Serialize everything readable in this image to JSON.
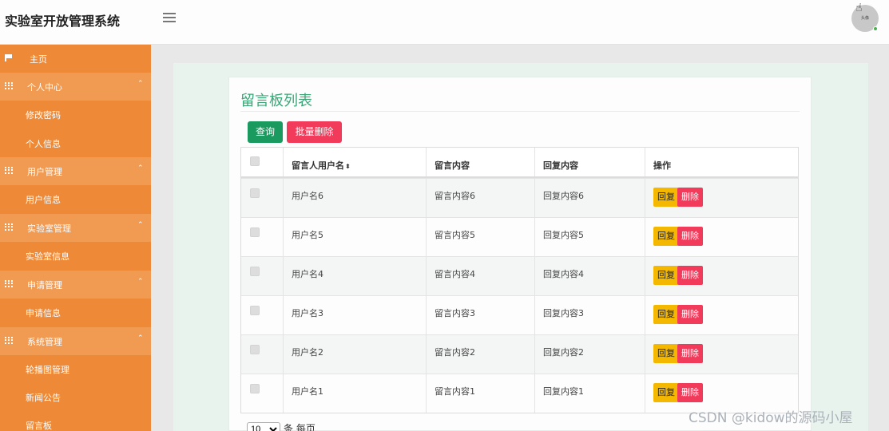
{
  "header": {
    "title": "实验室开放管理系统",
    "avatar_text": "头像"
  },
  "sidebar": {
    "items": [
      {
        "label": "主页",
        "type": "home",
        "icon": "flag-icon"
      },
      {
        "label": "个人中心",
        "type": "group",
        "icon": "grid-icon",
        "caret": "⌃"
      },
      {
        "label": "修改密码",
        "type": "sub"
      },
      {
        "label": "个人信息",
        "type": "sub"
      },
      {
        "label": "用户管理",
        "type": "group",
        "icon": "grid-icon",
        "caret": "⌃"
      },
      {
        "label": "用户信息",
        "type": "sub"
      },
      {
        "label": "实验室管理",
        "type": "group",
        "icon": "grid-icon",
        "caret": "⌃"
      },
      {
        "label": "实验室信息",
        "type": "sub"
      },
      {
        "label": "申请管理",
        "type": "group",
        "icon": "grid-icon",
        "caret": "⌃"
      },
      {
        "label": "申请信息",
        "type": "sub"
      },
      {
        "label": "系统管理",
        "type": "group",
        "icon": "grid-icon",
        "caret": "⌃"
      },
      {
        "label": "轮播图管理",
        "type": "sub"
      },
      {
        "label": "新闻公告",
        "type": "sub"
      },
      {
        "label": "留言板",
        "type": "sub"
      }
    ]
  },
  "main": {
    "title": "留言板列表",
    "search_label": "查询",
    "batch_delete_label": "批量删除",
    "table": {
      "columns": [
        "留言人用户名",
        "留言内容",
        "回复内容",
        "操作"
      ],
      "sort_icon": "⬍",
      "rows": [
        {
          "username": "用户名6",
          "content": "留言内容6",
          "reply": "回复内容6"
        },
        {
          "username": "用户名5",
          "content": "留言内容5",
          "reply": "回复内容5"
        },
        {
          "username": "用户名4",
          "content": "留言内容4",
          "reply": "回复内容4"
        },
        {
          "username": "用户名3",
          "content": "留言内容3",
          "reply": "回复内容3"
        },
        {
          "username": "用户名2",
          "content": "留言内容2",
          "reply": "回复内容2"
        },
        {
          "username": "用户名1",
          "content": "留言内容1",
          "reply": "回复内容1"
        }
      ],
      "reply_label": "回复",
      "delete_label": "删除"
    },
    "pager": {
      "page_size": "10",
      "suffix": "条 每页"
    }
  },
  "watermark": "CSDN @kidow的源码小屋",
  "colors": {
    "sidebar": "#ee8a37",
    "accent_green": "#3aa676",
    "danger": "#f23a5a",
    "warning": "#f5b800"
  }
}
